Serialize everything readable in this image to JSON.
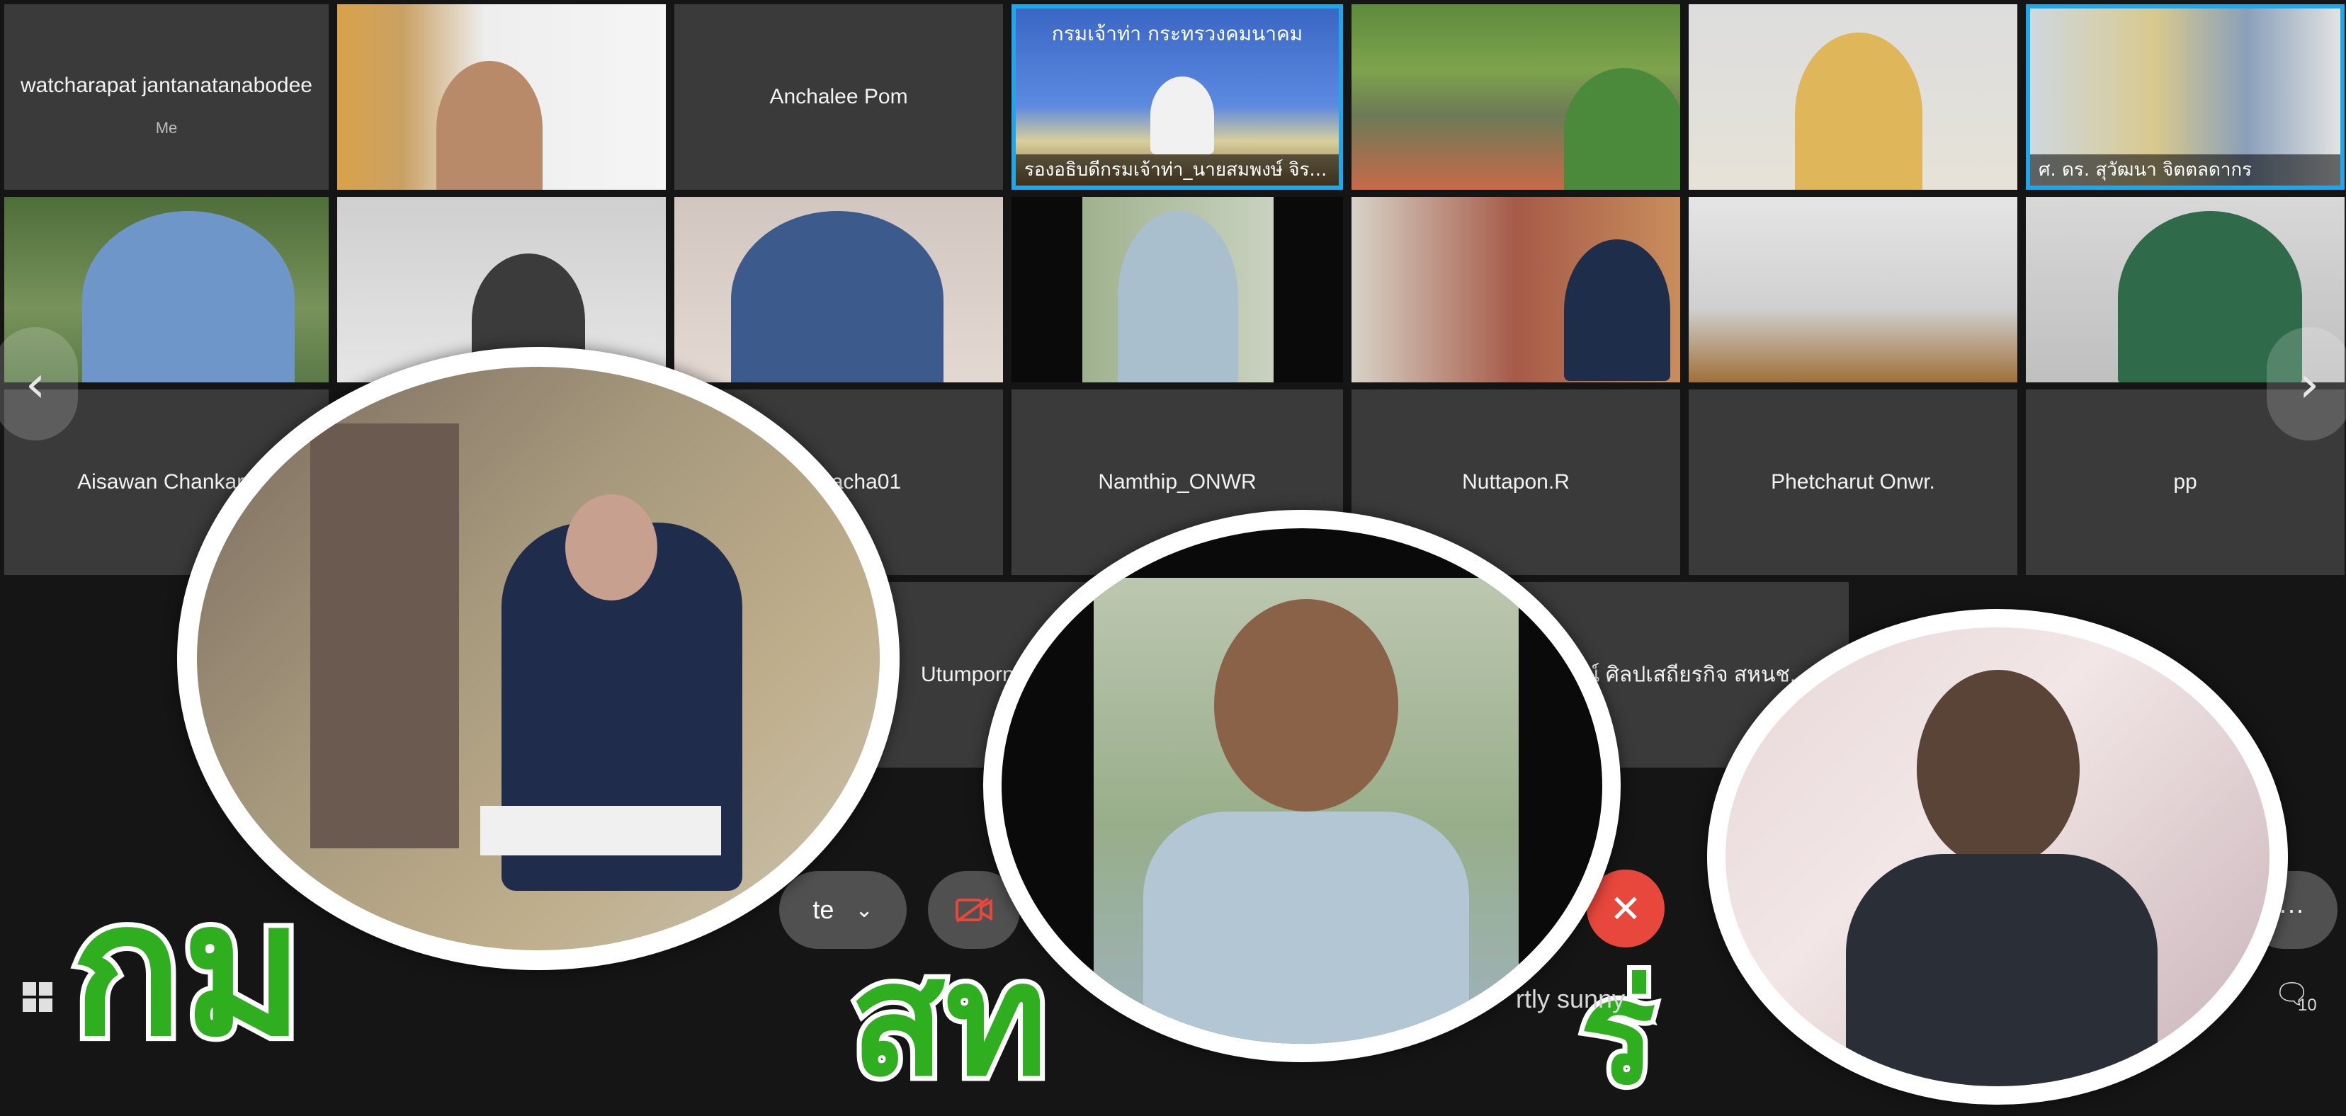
{
  "participants": {
    "row1": {
      "self_name": "watcharapat jantanatanabodee",
      "self_sub": "Me",
      "anchalee": "Anchalee Pom",
      "active_caption": "รองอธิบดีกรมเจ้าท่า_นายสมพงษ์ จิร...",
      "active_banner": "กรมเจ้าท่า กระทรวงคมนาคม",
      "last_caption": "ศ. ดร. สุวัฒนา จิตตลดากร"
    },
    "row3": {
      "aisawan": "Aisawan Chankarn",
      "natacha": "natacha01",
      "namthip": "Namthip_ONWR",
      "nuttapon": "Nuttapon.R",
      "phetcharut": "Phetcharut Onwr.",
      "pp": "pp"
    },
    "row4": {
      "utumporn": "Utumporn.K",
      "thai_name": "ธิญาณ์ ศิลปเสถียรกิจ สหนช."
    }
  },
  "nav": {
    "prev": "‹",
    "next": "›"
  },
  "toolbar": {
    "mute_label": "te",
    "end_icon": "✕",
    "more_icon": "···"
  },
  "overlay": {
    "title_left": "กม",
    "title_mid": "สท",
    "title_right": "ร่"
  },
  "taskbar": {
    "weather": "rtly sunny",
    "notification_count": "10"
  },
  "colors": {
    "active_border": "#22a6ea",
    "end_call": "#e8473c",
    "title_green": "#2fae20"
  }
}
